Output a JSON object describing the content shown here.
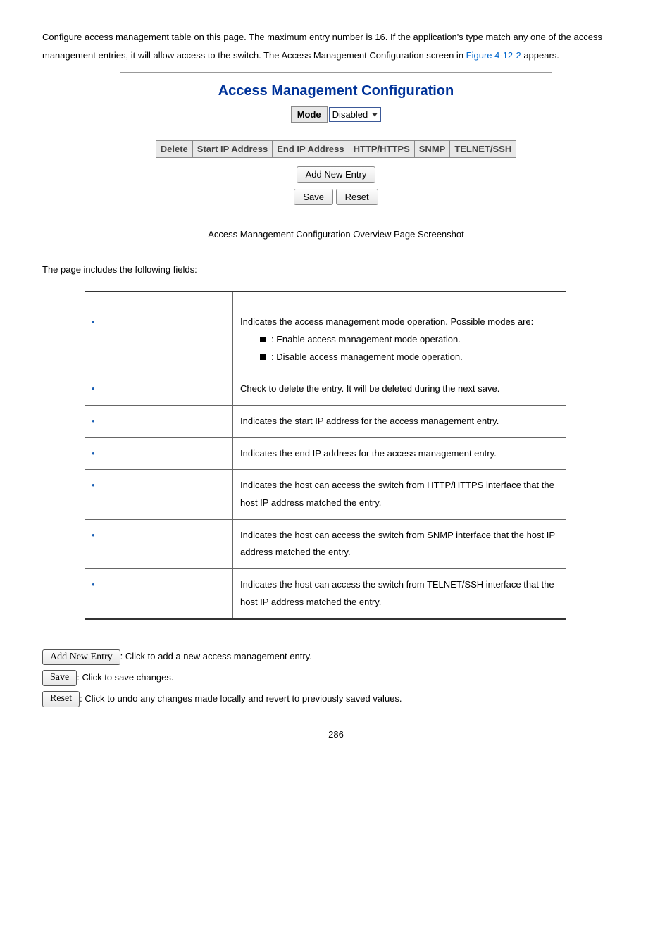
{
  "intro": {
    "text_before_link": "Configure access management table on this page. The maximum entry number is 16. If the application's type match any one of the access management entries, it will allow access to the switch. The Access Management Configuration screen in ",
    "link": "Figure 4-12-2",
    "text_after_link": " appears."
  },
  "figure": {
    "title": "Access Management Configuration",
    "mode_label": "Mode",
    "mode_value": "Disabled",
    "headers": [
      "Delete",
      "Start IP Address",
      "End IP Address",
      "HTTP/HTTPS",
      "SNMP",
      "TELNET/SSH"
    ],
    "add_button": "Add New Entry",
    "save_button": "Save",
    "reset_button": "Reset"
  },
  "caption": "Access Management Configuration Overview Page Screenshot",
  "fields_label": "The page includes the following fields:",
  "fields": [
    {
      "desc_intro": "Indicates the access management mode operation. Possible modes are:",
      "sub": [
        {
          "text": ": Enable access management mode operation."
        },
        {
          "text": ": Disable access management mode operation."
        }
      ]
    },
    {
      "desc": "Check to delete the entry. It will be deleted during the next save."
    },
    {
      "desc": "Indicates the start IP address for the access management entry."
    },
    {
      "desc": "Indicates the end IP address for the access management entry."
    },
    {
      "desc": "Indicates the host can access the switch from HTTP/HTTPS interface that the host IP address matched the entry."
    },
    {
      "desc": "Indicates the host can access the switch from SNMP interface that the host IP address matched the entry."
    },
    {
      "desc": "Indicates the host can access the switch from TELNET/SSH interface that the host IP address matched the entry."
    }
  ],
  "buttons": {
    "add": {
      "label": "Add New Entry",
      "desc": ": Click to add a new access management entry."
    },
    "save": {
      "label": "Save",
      "desc": ": Click to save changes."
    },
    "reset": {
      "label": "Reset",
      "desc": ": Click to undo any changes made locally and revert to previously saved values."
    }
  },
  "page_number": "286"
}
